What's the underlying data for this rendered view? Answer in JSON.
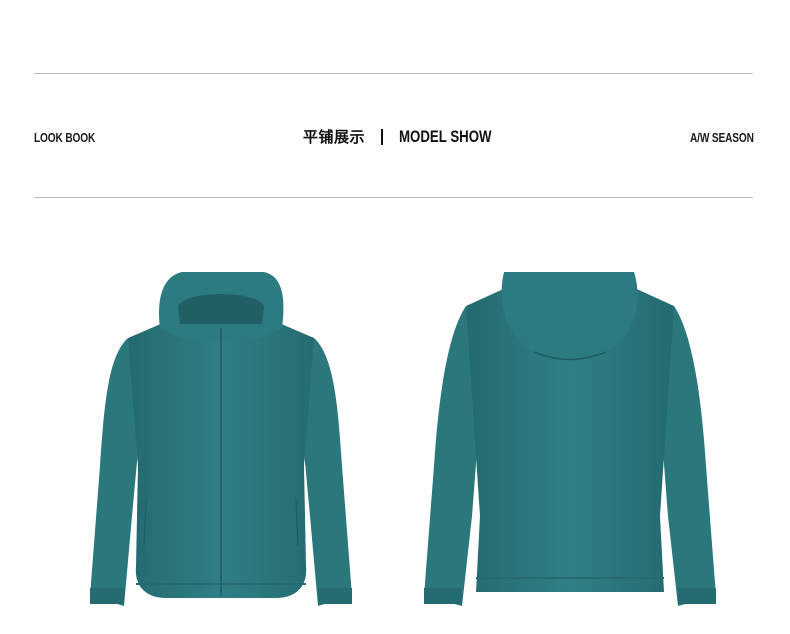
{
  "header": {
    "left_label": "LOOK BOOK",
    "cn_title": "平铺展示",
    "en_title": "MODEL SHOW",
    "right_label": "A/W SEASON"
  },
  "colors": {
    "jacket": "#2f7f84",
    "jacket_shadow": "#246a70",
    "jacket_highlight": "#3a8f94",
    "rule": "#bdbdbd"
  },
  "images": [
    {
      "name": "jacket-front",
      "view": "front"
    },
    {
      "name": "jacket-back",
      "view": "back"
    }
  ]
}
